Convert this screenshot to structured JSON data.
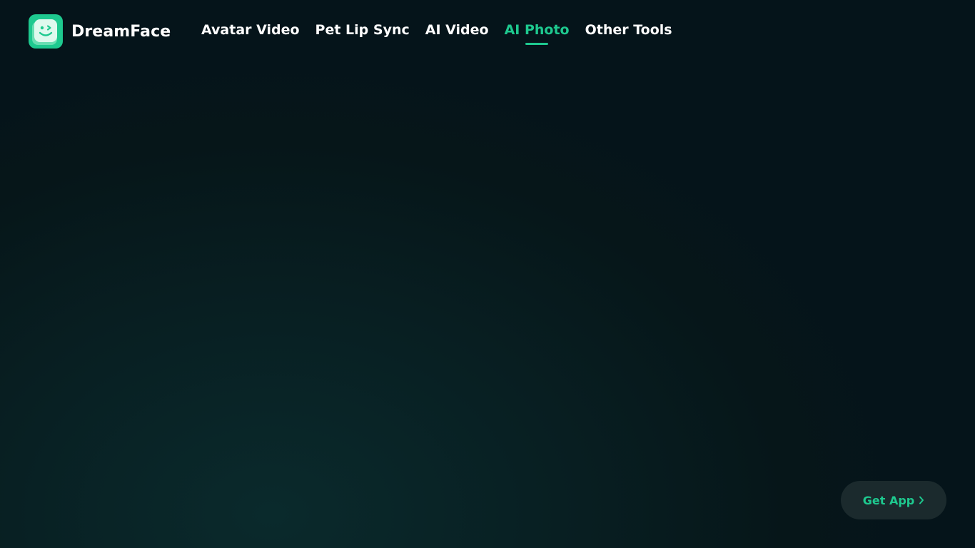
{
  "brand": {
    "name": "DreamFace",
    "logo_icon": "smiley-face-app-icon"
  },
  "nav": {
    "items": [
      {
        "label": "Avatar Video",
        "active": false
      },
      {
        "label": "Pet Lip Sync",
        "active": false
      },
      {
        "label": "AI Video",
        "active": false
      },
      {
        "label": "AI Photo",
        "active": true
      },
      {
        "label": "Other Tools",
        "active": false
      }
    ]
  },
  "cta": {
    "label": "Get App",
    "icon": "chevron-right-icon"
  },
  "colors": {
    "accent": "#1ec98f",
    "background": "#061a1d",
    "button_bg": "#1b2a2d",
    "text": "#ffffff"
  }
}
